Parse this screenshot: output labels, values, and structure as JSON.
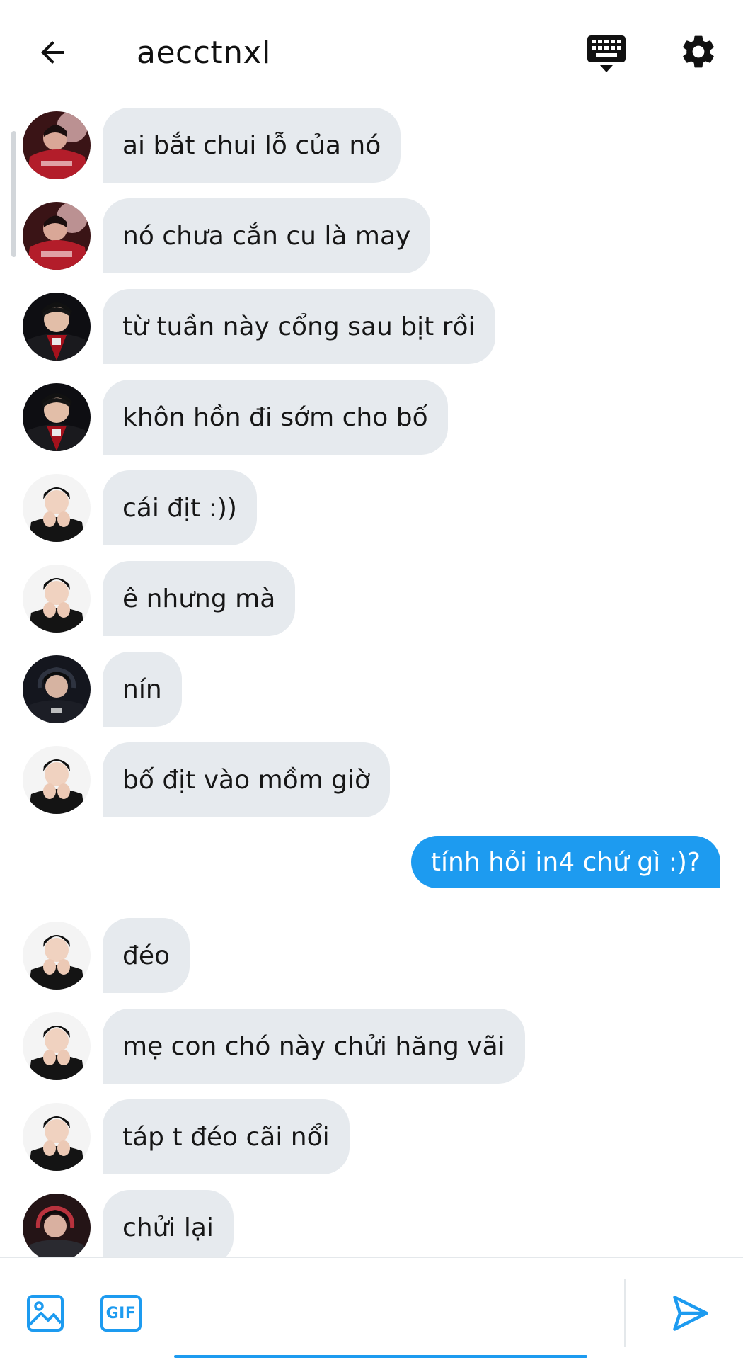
{
  "header": {
    "title": "aecctnxl",
    "back_icon": "arrow-left-icon",
    "keyboard_icon": "keyboard-icon",
    "settings_icon": "gear-icon"
  },
  "colors": {
    "accent": "#1d9bf0",
    "received_bubble": "#e6eaee",
    "background": "#ffffff"
  },
  "messages": [
    {
      "text": "ai bắt chui lỗ của nó",
      "direction": "received",
      "avatar": "avatar-red-jersey"
    },
    {
      "text": "nó chưa cắn cu là may",
      "direction": "received",
      "avatar": "avatar-red-jersey"
    },
    {
      "text": "từ tuần này cổng sau bịt rồi",
      "direction": "received",
      "avatar": "avatar-dark-jacket"
    },
    {
      "text": "khôn hồn đi sớm cho bố",
      "direction": "received",
      "avatar": "avatar-dark-jacket"
    },
    {
      "text": "cái địt :))",
      "direction": "received",
      "avatar": "avatar-hands-chin"
    },
    {
      "text": "ê nhưng mà",
      "direction": "received",
      "avatar": "avatar-hands-chin"
    },
    {
      "text": "nín",
      "direction": "received",
      "avatar": "avatar-headset-dark"
    },
    {
      "text": "bố địt vào mồm giờ",
      "direction": "received",
      "avatar": "avatar-hands-chin"
    },
    {
      "text": "tính hỏi in4 chứ gì :)?",
      "direction": "sent"
    },
    {
      "text": "đéo",
      "direction": "received",
      "avatar": "avatar-hands-chin"
    },
    {
      "text": "mẹ con chó này chửi hăng vãi",
      "direction": "received",
      "avatar": "avatar-hands-chin"
    },
    {
      "text": "táp t đéo cãi nổi",
      "direction": "received",
      "avatar": "avatar-hands-chin"
    },
    {
      "text": "chửi lại",
      "direction": "received",
      "avatar": "avatar-headset-red"
    }
  ],
  "composer": {
    "media_icon": "image-icon",
    "gif_label": "GIF",
    "send_icon": "send-icon",
    "input_value": ""
  }
}
